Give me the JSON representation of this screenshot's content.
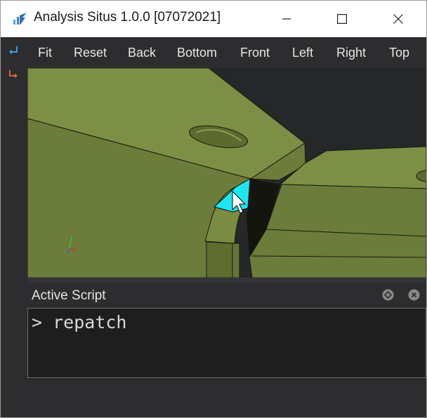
{
  "window": {
    "title": "Analysis Situs 1.0.0 [07072021]",
    "controls": {
      "minimize_icon": "minimize-icon",
      "maximize_icon": "maximize-icon",
      "close_icon": "close-icon"
    }
  },
  "left_strip": {
    "icons": [
      "undo-icon",
      "redo-icon"
    ],
    "colors": {
      "undo": "#3e9be0",
      "redo": "#e2643c"
    }
  },
  "toolbar": {
    "buttons": [
      "Fit",
      "Reset",
      "Back",
      "Bottom",
      "Front",
      "Left",
      "Right",
      "Top"
    ]
  },
  "viewport": {
    "colors": {
      "background": "#262729",
      "model": "#6e7d3c",
      "selection": "#1ee6f0"
    }
  },
  "dock": {
    "title": "Active Script",
    "float_icon": "float-icon",
    "close_icon": "close-icon"
  },
  "console": {
    "prompt": "> ",
    "command": "repatch"
  }
}
